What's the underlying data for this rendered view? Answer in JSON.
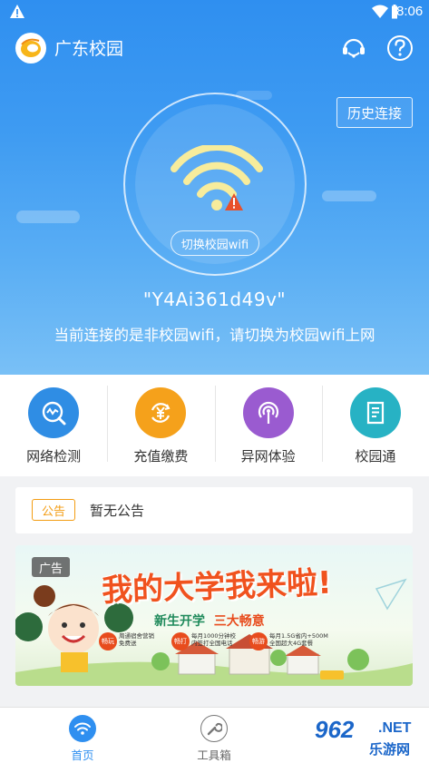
{
  "status_bar": {
    "time": "8:06",
    "icons": [
      "warning-icon",
      "wifi-icon",
      "battery-icon"
    ]
  },
  "app": {
    "title": "广东校园",
    "actions": [
      "headset-support-icon",
      "help-icon"
    ]
  },
  "hero": {
    "history_button": "历史连接",
    "switch_button": "切换校园wifi",
    "ssid": "\"Y4Ai361d49v\"",
    "status_message": "当前连接的是非校园wifi，请切换为校园wifi上网",
    "wifi_state": "warning"
  },
  "features": [
    {
      "label": "网络检测",
      "icon": "network-check-icon",
      "color": "#2f8de4"
    },
    {
      "label": "充值缴费",
      "icon": "yuan-recharge-icon",
      "color": "#f5a11b"
    },
    {
      "label": "异网体验",
      "icon": "signal-broadcast-icon",
      "color": "#9a5bd0"
    },
    {
      "label": "校园通",
      "icon": "document-icon",
      "color": "#27b2c4"
    }
  ],
  "notice": {
    "tag": "公告",
    "text": "暂无公告"
  },
  "banner": {
    "tag": "广告",
    "headline": "我的大学我来啦!",
    "subline_prefix": "新生开学",
    "subline_highlight": "三大畅意",
    "promos": [
      {
        "badge": "畅玩",
        "text": "周通宿舍营销\n免费送"
      },
      {
        "badge": "畅打",
        "text": "每月1000分钟校\n内签打全国电话"
      },
      {
        "badge": "畅游",
        "text": "每月1.5G省内+500M\n全国超大4G套餐"
      }
    ]
  },
  "bottom_nav": [
    {
      "label": "首页",
      "icon": "wifi-home-icon",
      "active": true
    },
    {
      "label": "工具箱",
      "icon": "wrench-icon",
      "active": false
    }
  ],
  "watermark": {
    "number": "962",
    "suffix": ".NET",
    "text": "乐游网"
  },
  "colors": {
    "primary": "#2f8ff0",
    "accent_orange": "#f39c12",
    "warning_red": "#e84c1d"
  }
}
